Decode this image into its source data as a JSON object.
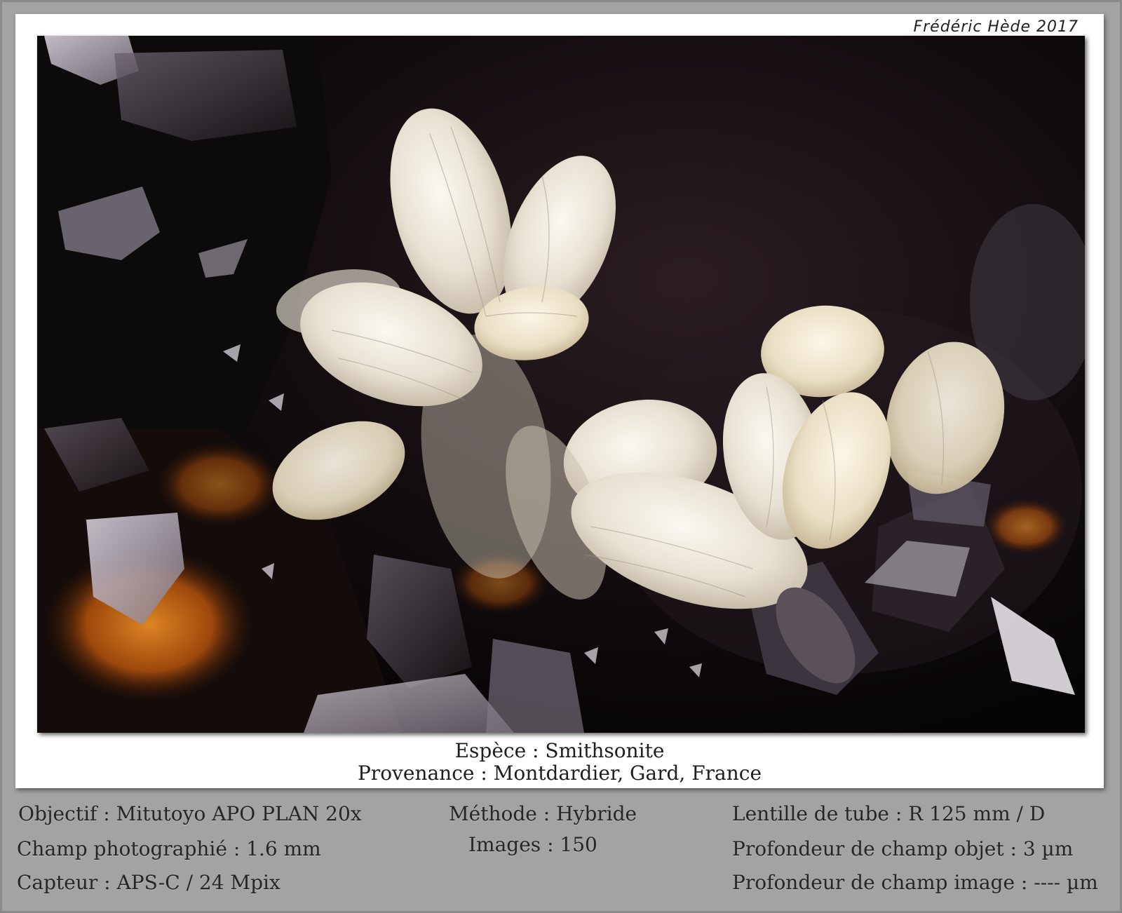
{
  "credit": "Frédéric Hède 2017",
  "caption": {
    "species": "Espèce : Smithsonite",
    "origin": "Provenance : Montdardier, Gard, France"
  },
  "specs": {
    "objective": "Objectif : Mitutoyo APO PLAN 20x",
    "field": "Champ photographié : 1.6 mm",
    "sensor": "Capteur : APS-C / 24 Mpix",
    "method": "Méthode : Hybride",
    "images": "Images : 150",
    "tube_lens": "Lentille de tube : R 125 mm / D",
    "object_dof": "Profondeur de champ objet : 3 µm",
    "image_dof": "Profondeur de champ image : ---- µm"
  },
  "colors": {
    "background": "#a3a3a3",
    "card": "#ffffff",
    "crystal": "#efe9dc",
    "matrix_dark": "#0b0809",
    "matrix_amber": "#b5520c"
  }
}
